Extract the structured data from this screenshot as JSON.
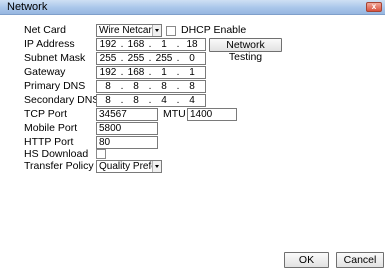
{
  "window": {
    "title": "Network",
    "close_label": "x"
  },
  "net_card": {
    "label": "Net Card",
    "value": "Wire Netcard"
  },
  "dhcp": {
    "label": "DHCP Enable",
    "checked": false
  },
  "ip_address": {
    "label": "IP Address",
    "octets": [
      "192",
      "168",
      "1",
      "18"
    ],
    "dot": "."
  },
  "network_testing_label": "Network Testing",
  "subnet_mask": {
    "label": "Subnet Mask",
    "octets": [
      "255",
      "255",
      "255",
      "0"
    ]
  },
  "gateway": {
    "label": "Gateway",
    "octets": [
      "192",
      "168",
      "1",
      "1"
    ]
  },
  "primary_dns": {
    "label": "Primary DNS",
    "octets": [
      "8",
      "8",
      "8",
      "8"
    ]
  },
  "secondary_dns": {
    "label": "Secondary DNS",
    "octets": [
      "8",
      "8",
      "4",
      "4"
    ]
  },
  "tcp_port": {
    "label": "TCP Port",
    "value": "34567"
  },
  "mtu": {
    "label": "MTU",
    "value": "1400"
  },
  "mobile_port": {
    "label": "Mobile Port",
    "value": "5800"
  },
  "http_port": {
    "label": "HTTP Port",
    "value": "80"
  },
  "hs_download": {
    "label": "HS Download",
    "checked": false
  },
  "transfer_policy": {
    "label": "Transfer Policy",
    "value": "Quality Prefe"
  },
  "buttons": {
    "ok": "OK",
    "cancel": "Cancel"
  }
}
